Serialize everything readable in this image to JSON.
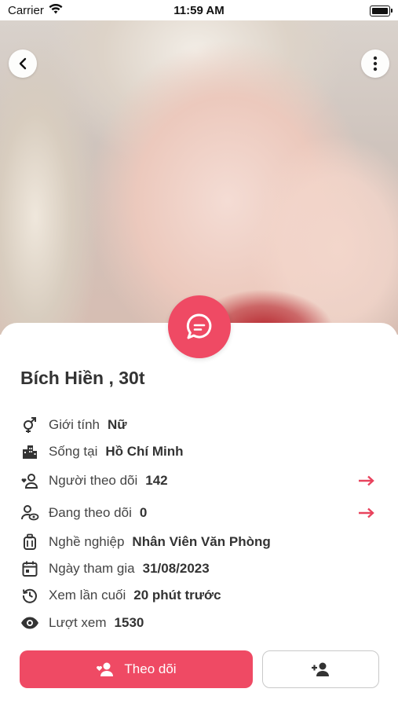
{
  "status_bar": {
    "carrier": "Carrier",
    "time": "11:59 AM"
  },
  "profile": {
    "name": "Bích Hiền , 30t"
  },
  "info_rows": [
    {
      "icon": "gender-icon",
      "label": "Giới tính",
      "value": "Nữ"
    },
    {
      "icon": "city-icon",
      "label": "Sống tại",
      "value": "Hồ Chí Minh"
    },
    {
      "icon": "followers-icon",
      "label": "Người theo dõi",
      "value": "142"
    },
    {
      "icon": "following-icon",
      "label": "Đang theo dõi",
      "value": "0"
    },
    {
      "icon": "job-icon",
      "label": "Nghề nghiệp",
      "value": "Nhân Viên Văn Phòng"
    },
    {
      "icon": "calendar-icon",
      "label": "Ngày tham gia",
      "value": "31/08/2023"
    },
    {
      "icon": "history-icon",
      "label": "Xem lần cuối",
      "value": "20 phút trước"
    },
    {
      "icon": "eye-icon",
      "label": "Lượt xem",
      "value": "1530"
    }
  ],
  "actions": {
    "follow_label": "Theo dõi"
  },
  "colors": {
    "accent": "#ef4a64",
    "arrow": "#e8435d",
    "text": "#333333"
  }
}
